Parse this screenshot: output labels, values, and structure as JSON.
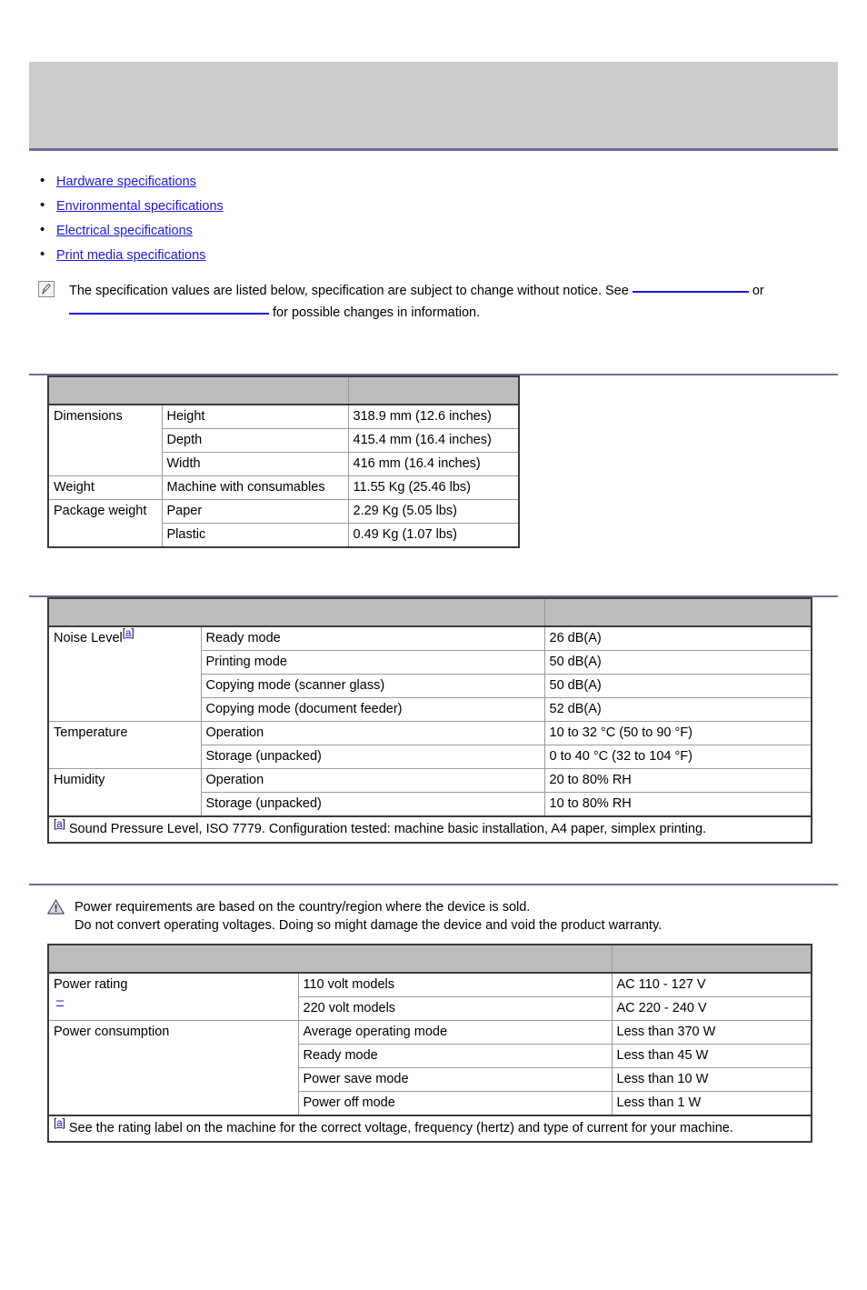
{
  "page": {
    "banner_title": "",
    "accent_rule_color": "#6b6b9e",
    "link_color": "#1a1ae6",
    "table_header_color": "#bdbdbd",
    "banner_color": "#cdcdcd"
  },
  "toc": {
    "items": [
      {
        "label": "Hardware specifications"
      },
      {
        "label": "Environmental specifications"
      },
      {
        "label": "Electrical specifications"
      },
      {
        "label": "Print media specifications"
      }
    ]
  },
  "note": {
    "icon": "note-pen-icon",
    "text_part1": "The specification values are listed below, specification are subject to change without notice. See ",
    "text_part2": " or",
    "text_part3": " for possible changes in information."
  },
  "hardware_table": {
    "header": [
      "",
      ""
    ],
    "rows": [
      {
        "c1": "Dimensions",
        "c2": "Height",
        "c3": "318.9 mm (12.6 inches)"
      },
      {
        "c1": "",
        "c2": "Depth",
        "c3": "415.4 mm (16.4 inches)"
      },
      {
        "c1": "",
        "c2": "Width",
        "c3": "416 mm (16.4 inches)"
      },
      {
        "c1": "Weight",
        "c2": "Machine with consumables",
        "c3": "11.55 Kg (25.46 lbs)"
      },
      {
        "c1": "Package weight",
        "c2": "Paper",
        "c3": "2.29 Kg (5.05 lbs)"
      },
      {
        "c1": "",
        "c2": "Plastic",
        "c3": "0.49 Kg (1.07 lbs)"
      }
    ]
  },
  "environmental_table": {
    "header": [
      "",
      ""
    ],
    "rows": [
      {
        "c1": "Noise Level",
        "c1_footnote": "a",
        "c2": "Ready mode",
        "c3": "26 dB(A)"
      },
      {
        "c1": "",
        "c2": "Printing mode",
        "c3": "50 dB(A)"
      },
      {
        "c1": "",
        "c2": "Copying mode (scanner glass)",
        "c3": "50 dB(A)"
      },
      {
        "c1": "",
        "c2": "Copying mode (document feeder)",
        "c3": "52 dB(A)"
      },
      {
        "c1": "Temperature",
        "c2": "Operation",
        "c3": "10 to 32 °C (50 to 90 °F)"
      },
      {
        "c1": "",
        "c2": "Storage (unpacked)",
        "c3": "0 to 40 °C (32 to 104 °F)"
      },
      {
        "c1": "Humidity",
        "c2": "Operation",
        "c3": "20 to 80% RH"
      },
      {
        "c1": "",
        "c2": "Storage (unpacked)",
        "c3": "10 to 80% RH"
      }
    ],
    "footnote_marker": "a",
    "footnote": "Sound Pressure Level, ISO 7779. Configuration tested: machine basic installation, A4 paper, simplex printing."
  },
  "electrical_warning": {
    "icon": "warning-triangle-icon",
    "line1": "Power requirements are based on the country/region where the device is sold.",
    "line2": "Do not convert operating voltages. Doing so might damage the device and void the product warranty."
  },
  "electrical_table": {
    "header": [
      "",
      ""
    ],
    "rows": [
      {
        "c1": "Power rating",
        "c2": "110 volt models",
        "c3": "AC 110 - 127 V"
      },
      {
        "c1": "",
        "c1_dash_link": "–",
        "c2": "220 volt models",
        "c3": "AC 220 - 240 V"
      },
      {
        "c1": "Power consumption",
        "c2": "Average operating mode",
        "c3": "Less than 370 W"
      },
      {
        "c1": "",
        "c2": "Ready mode",
        "c3": "Less than 45 W"
      },
      {
        "c1": "",
        "c2": "Power save mode",
        "c3": "Less than 10 W"
      },
      {
        "c1": "",
        "c2": "Power off mode",
        "c3": "Less than 1 W"
      }
    ],
    "footnote_marker": "a",
    "footnote": "See the rating label on the machine for the correct voltage, frequency (hertz) and type of current for your machine."
  }
}
